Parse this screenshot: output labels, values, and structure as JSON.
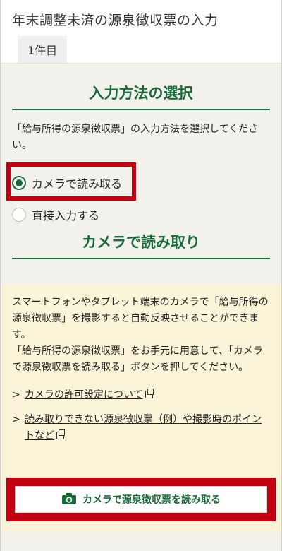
{
  "header": {
    "title": "年末調整未済の源泉徴収票の入力",
    "count": "1件目"
  },
  "input_method": {
    "heading": "入力方法の選択",
    "description": "「給与所得の源泉徴収票」の入力方法を選択してください。",
    "options": [
      {
        "label": "カメラで読み取る",
        "selected": true
      },
      {
        "label": "直接入力する",
        "selected": false
      }
    ]
  },
  "camera_section": {
    "heading": "カメラで読み取り",
    "paragraph1": "スマートフォンやタブレット端末のカメラで「給与所得の源泉徴収票」を撮影すると自動反映させることができます。",
    "paragraph2": "「給与所得の源泉徴収票」をお手元に用意して、「カメラで源泉徴収票を読み取る」ボタンを押してください。",
    "links": [
      "カメラの許可設定について",
      "読み取りできない源泉徴収票（例）や撮影時のポイントなど"
    ],
    "button_label": "カメラで源泉徴収票を読み取る"
  },
  "colors": {
    "accent_green": "#1a6b3a",
    "highlight_red": "#c3000f",
    "info_bg": "#fbf4d8"
  }
}
